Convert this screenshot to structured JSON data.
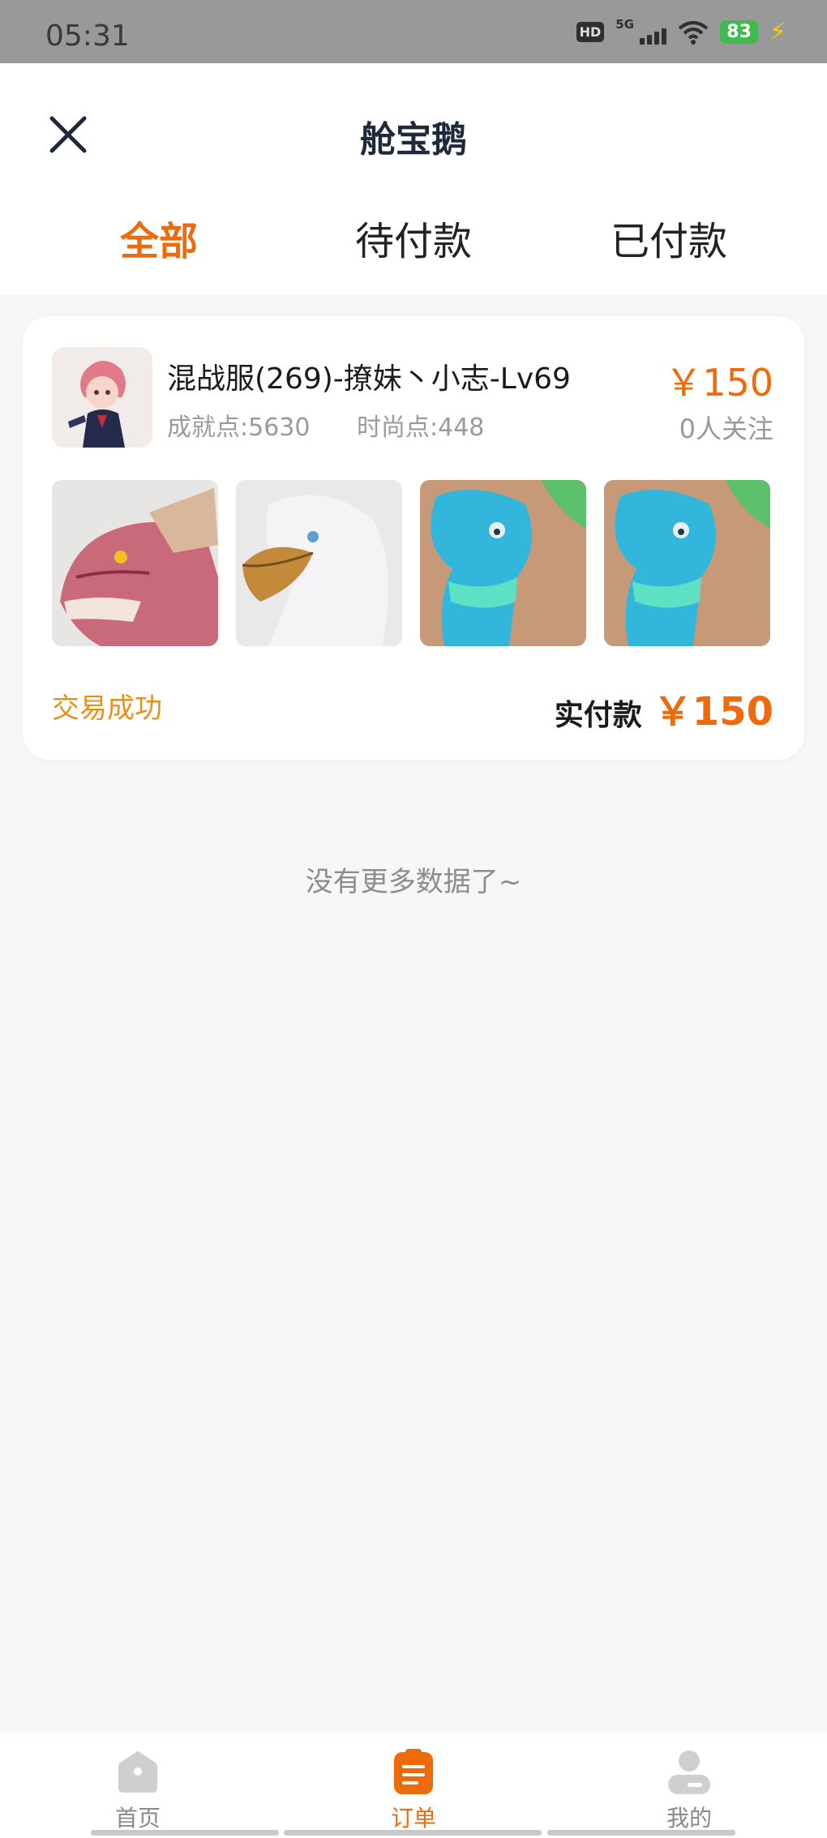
{
  "status_bar": {
    "time": "05:31",
    "hd": "HD",
    "network": "5G",
    "battery": "83"
  },
  "header": {
    "title": "舱宝鹅",
    "close_icon": "close-icon"
  },
  "tabs": [
    {
      "label": "全部",
      "active": true
    },
    {
      "label": "待付款",
      "active": false
    },
    {
      "label": "已付款",
      "active": false
    }
  ],
  "order": {
    "title": "混战服(269)-撩妹丶小志-Lv69",
    "achievement": "成就点:5630",
    "fashion": "时尚点:448",
    "price": "￥150",
    "followers": "0人关注",
    "status": "交易成功",
    "paid_label": "实付款",
    "paid_amount": "￥150",
    "thumbnails": [
      "red-dragon-mount",
      "white-eagle-mount",
      "blue-bird-mount",
      "blue-bird-mount"
    ]
  },
  "empty_hint": "没有更多数据了~",
  "bottom_nav": [
    {
      "label": "首页",
      "icon": "home-icon",
      "active": false
    },
    {
      "label": "订单",
      "icon": "orders-icon",
      "active": true
    },
    {
      "label": "我的",
      "icon": "profile-icon",
      "active": false
    }
  ],
  "colors": {
    "accent": "#ee6b0c",
    "status": "#e8911a"
  }
}
